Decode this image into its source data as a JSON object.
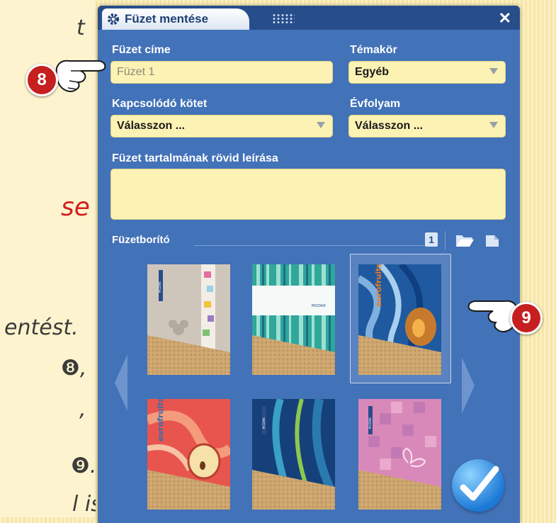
{
  "dialog": {
    "title": "Füzet mentése",
    "close_symbol": "✕"
  },
  "form": {
    "title_label": "Füzet címe",
    "title_placeholder": "Füzet 1",
    "topic_label": "Témakör",
    "topic_value": "Egyéb",
    "volume_label": "Kapcsolódó kötet",
    "volume_value": "Válasszon ...",
    "grade_label": "Évfolyam",
    "grade_value": "Válasszon ...",
    "description_label": "Füzet tartalmának rövid leírása",
    "cover_label": "Füzetborító",
    "page_tool_number": "1"
  },
  "covers": [
    {
      "name": "gifts",
      "brand": "MOZAIK"
    },
    {
      "name": "stripes",
      "brand": "MOZAIK"
    },
    {
      "name": "plum",
      "brand": "eurofruits"
    },
    {
      "name": "apple",
      "brand": "eurofruits"
    },
    {
      "name": "waves",
      "brand": "MOZAIK"
    },
    {
      "name": "butterfly",
      "brand": "MOZAIK"
    }
  ],
  "callouts": [
    {
      "number": "8"
    },
    {
      "number": "9"
    }
  ],
  "background_text": [
    {
      "text": "t"
    },
    {
      "text": "se"
    },
    {
      "text": "entést."
    },
    {
      "text": "❽,"
    },
    {
      "text": ","
    },
    {
      "text": "❾."
    },
    {
      "text": "l is."
    }
  ],
  "colors": {
    "dialog_bg": "#4272b8",
    "titlebar": "#284d8b",
    "field_bg": "#fbf2b4",
    "badge_red": "#c61f1f"
  }
}
